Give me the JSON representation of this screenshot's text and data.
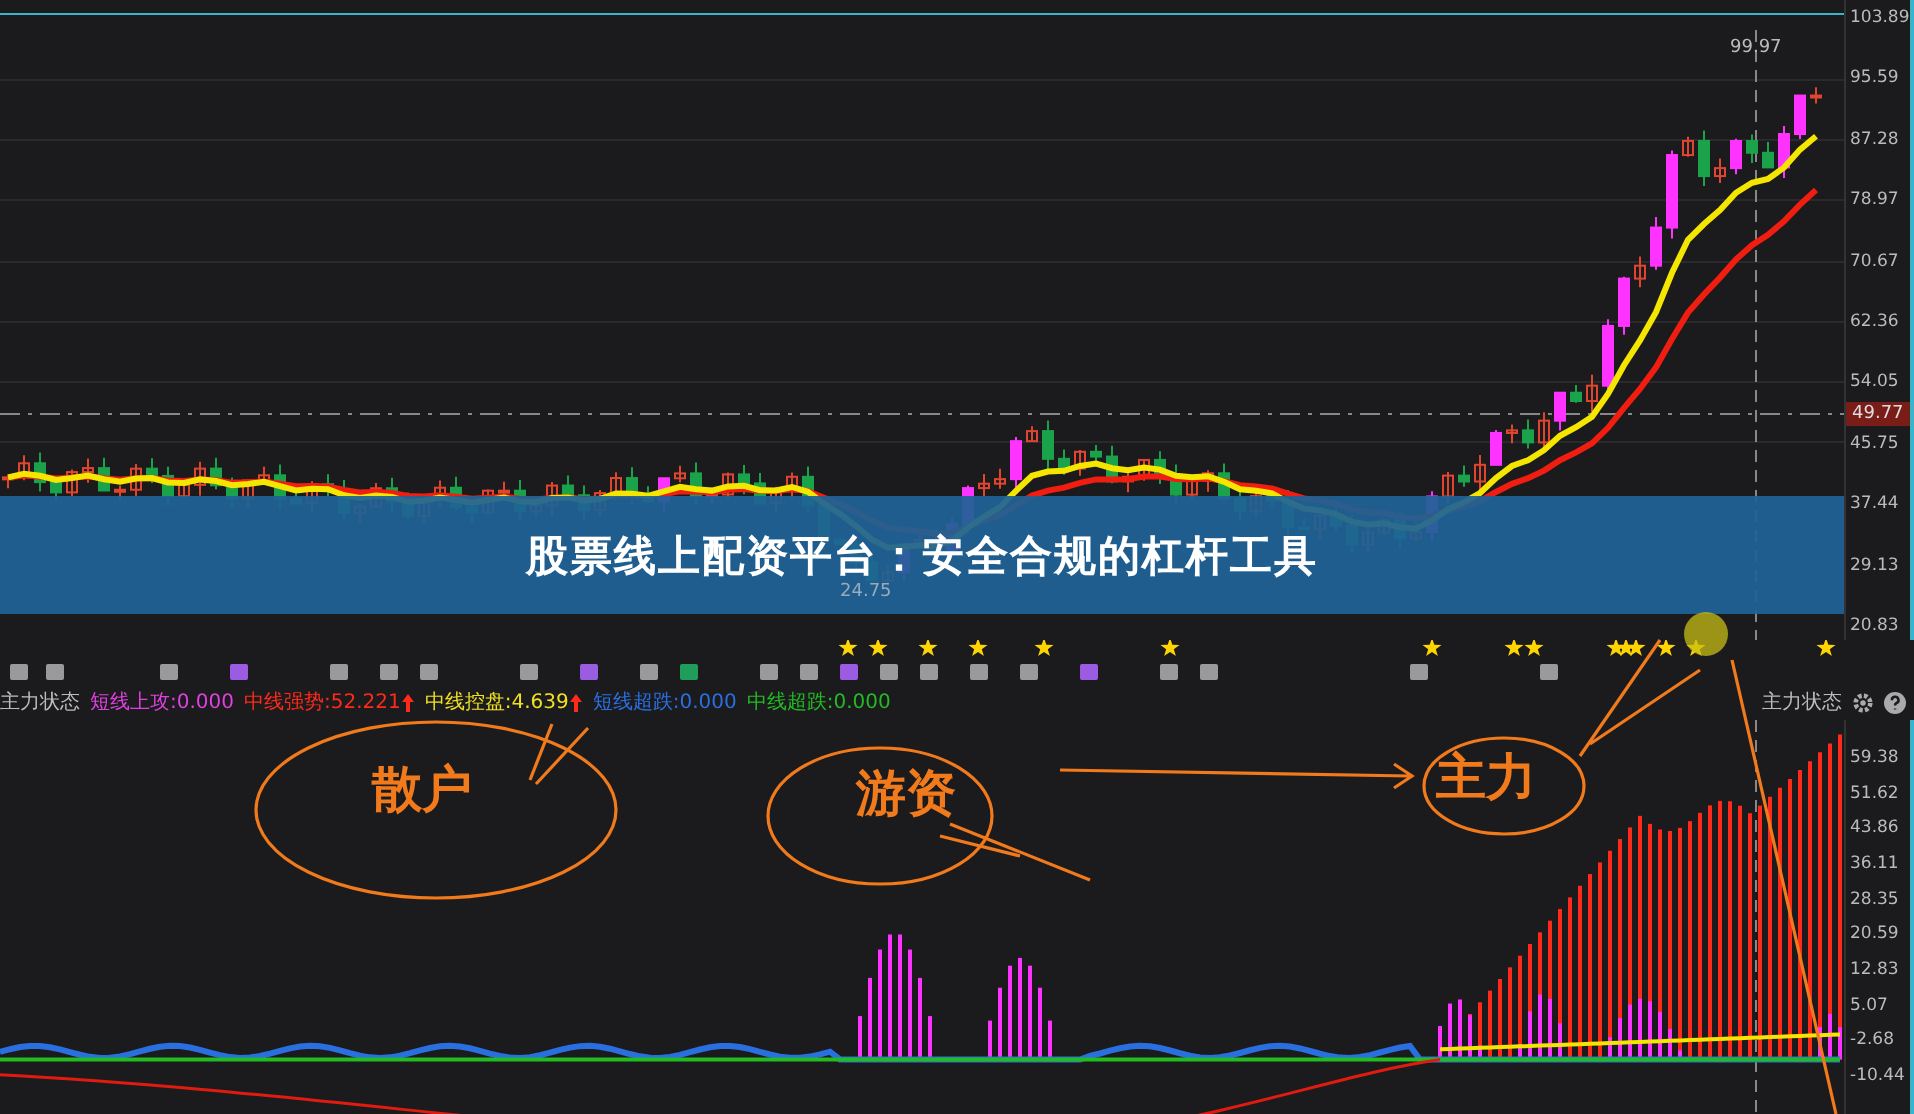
{
  "price_panel": {
    "axis_labels": [
      "103.89",
      "95.59",
      "87.28",
      "78.97",
      "70.67",
      "62.36",
      "54.05",
      "45.75",
      "37.44",
      "29.13",
      "20.83"
    ],
    "current_price": "49.77",
    "high_label": "99.97",
    "low_label": "24.75"
  },
  "banner": {
    "title": "股票线上配资平台：安全合规的杠杆工具"
  },
  "indicator": {
    "name": "主力状态",
    "title_right": "主力状态",
    "legend": [
      {
        "label": "短线上攻:0.000",
        "color": "#e040e0",
        "arrow": false
      },
      {
        "label": "中线强势:52.221",
        "color": "#ff2a1a",
        "arrow": true
      },
      {
        "label": "中线控盘:4.639",
        "color": "#f0e020",
        "arrow": true
      },
      {
        "label": "短线超跌:0.000",
        "color": "#2a6fe0",
        "arrow": false
      },
      {
        "label": "中线超跌:0.000",
        "color": "#22bb22",
        "arrow": false
      }
    ],
    "axis_labels": [
      "59.38",
      "51.62",
      "43.86",
      "36.11",
      "28.35",
      "20.59",
      "12.83",
      "5.07",
      "-2.68",
      "-10.44"
    ]
  },
  "annotations": [
    {
      "label": "散户"
    },
    {
      "label": "游资"
    },
    {
      "label": "主力"
    }
  ]
}
